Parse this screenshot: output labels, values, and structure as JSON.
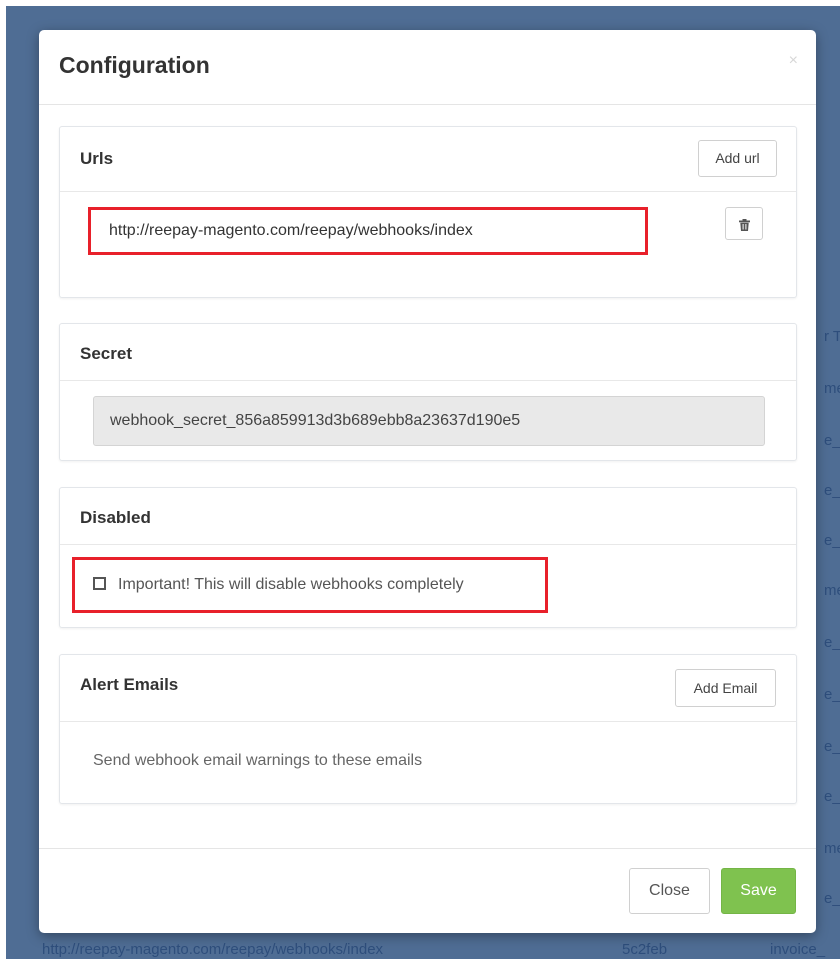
{
  "background": {
    "right_fragments": [
      "r T",
      "me",
      "e_",
      "e_",
      "e_",
      "me",
      "e_",
      "e_",
      "e_",
      "e_",
      "me",
      "e_"
    ],
    "footer_row": {
      "url": "http://reepay-magento.com/reepay/webhooks/index",
      "id": "5c2feb",
      "event": "invoice_"
    }
  },
  "modal": {
    "title": "Configuration",
    "close_glyph": "×"
  },
  "urls": {
    "title": "Urls",
    "add_label": "Add url",
    "url_value": "http://reepay-magento.com/reepay/webhooks/index",
    "delete_icon": "trash-icon"
  },
  "secret": {
    "title": "Secret",
    "value": "webhook_secret_856a859913d3b689ebb8a23637d190e5"
  },
  "disabled": {
    "title": "Disabled",
    "checkbox_label": "Important! This will disable webhooks completely",
    "checked": false
  },
  "alerts": {
    "title": "Alert Emails",
    "add_label": "Add Email",
    "description": "Send webhook email warnings to these emails"
  },
  "footer": {
    "close_label": "Close",
    "save_label": "Save"
  },
  "colors": {
    "backdrop": "#4f6d94",
    "highlight": "#e8202a",
    "save": "#7fc24f"
  }
}
